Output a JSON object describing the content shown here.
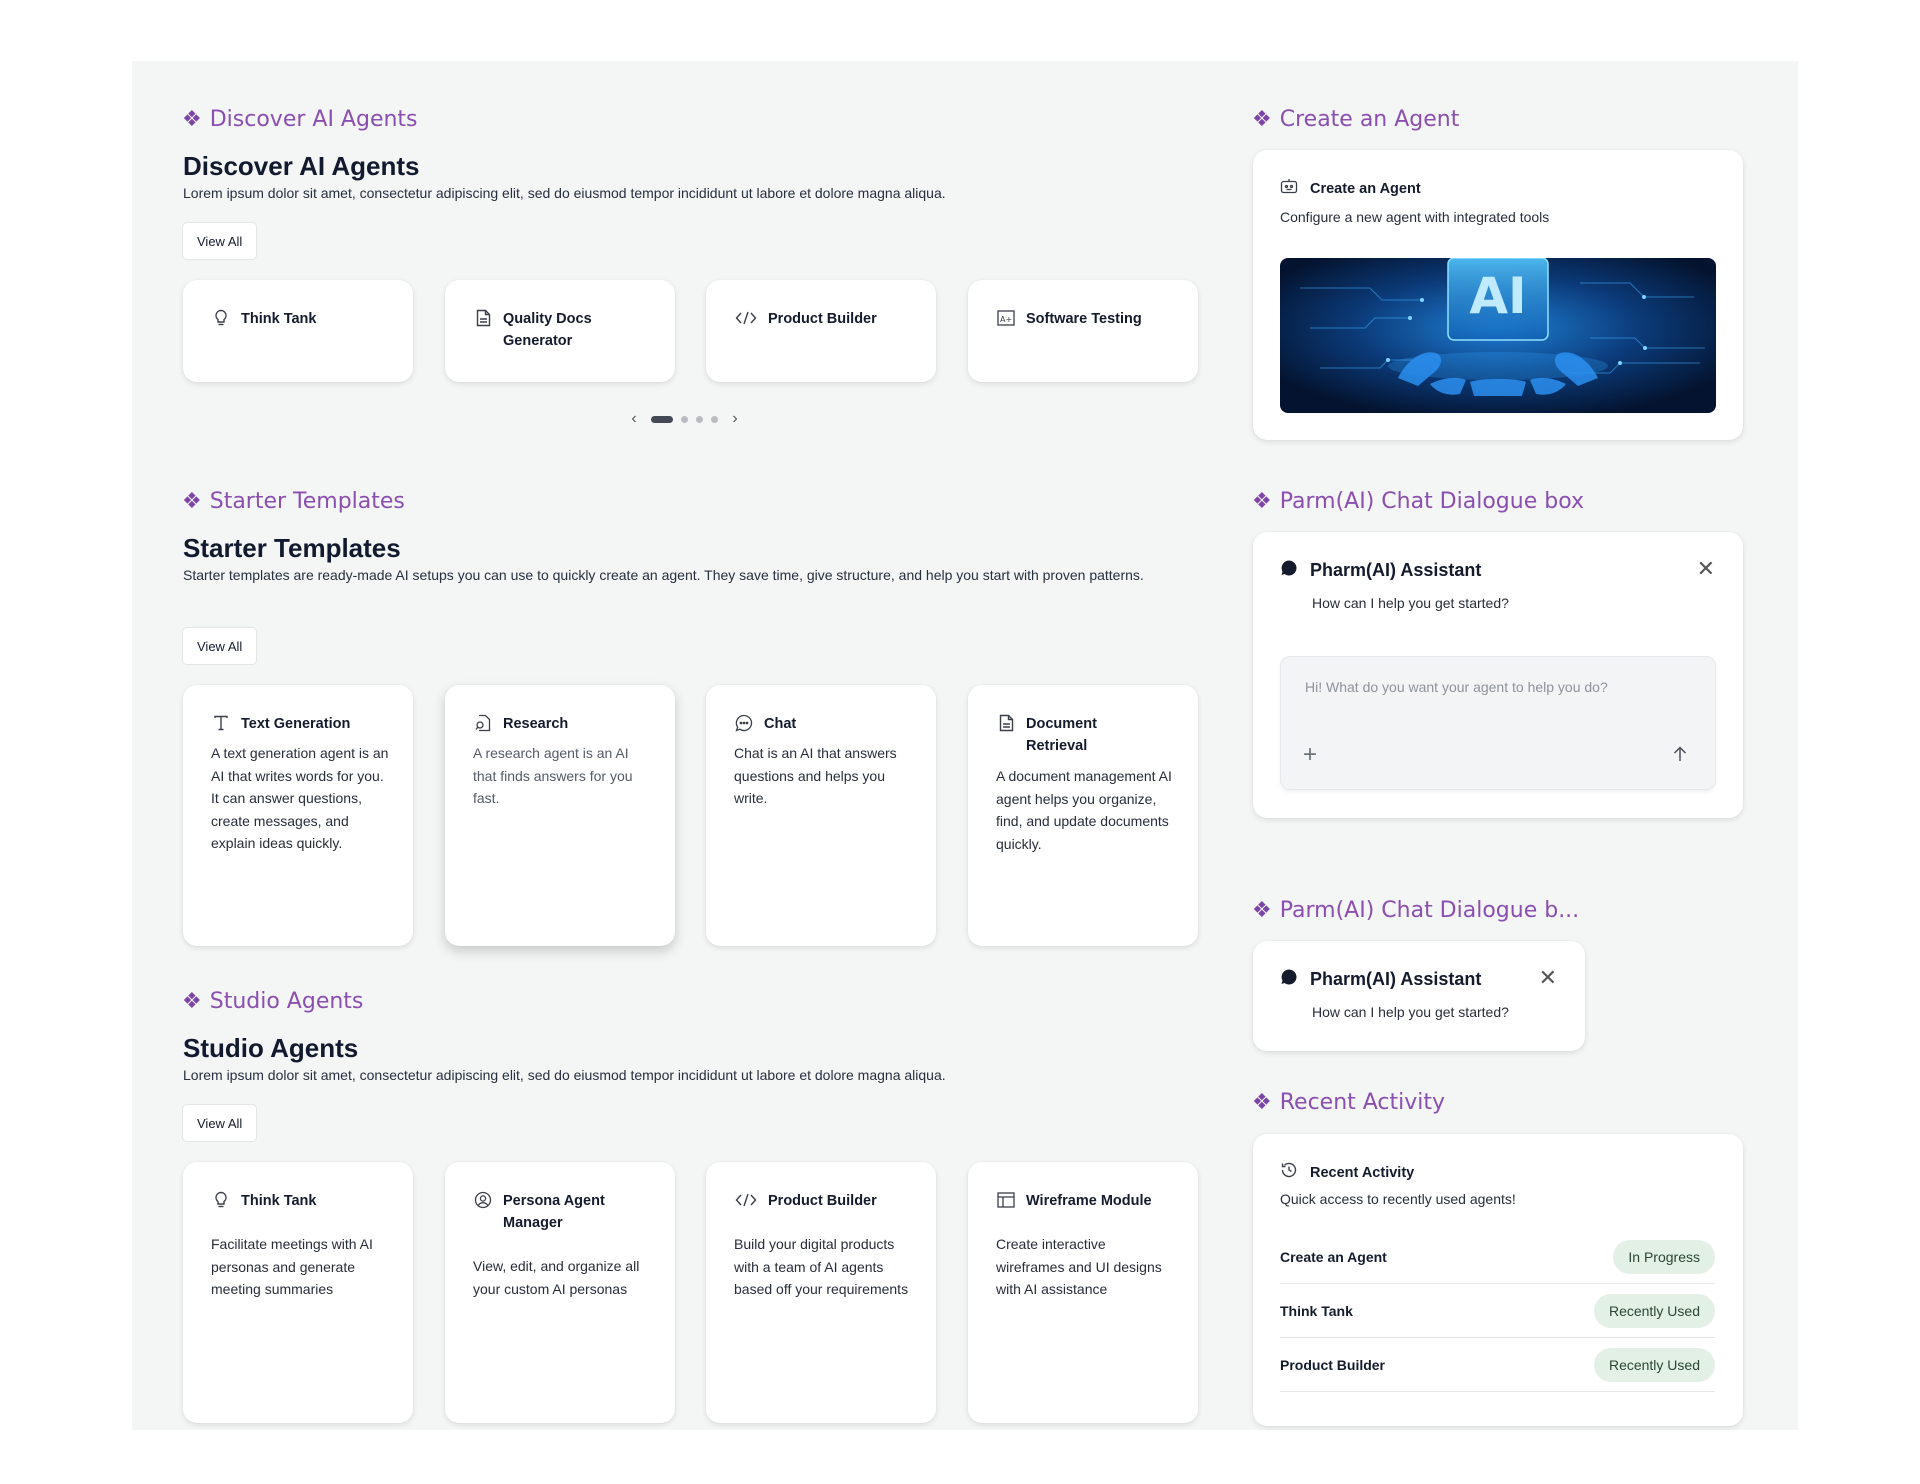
{
  "discover": {
    "label": "Discover AI Agents",
    "title": "Discover AI Agents",
    "desc": "Lorem ipsum dolor sit amet, consectetur adipiscing elit, sed do eiusmod tempor incididunt ut labore et dolore magna aliqua.",
    "view_all": "View All",
    "cards": [
      {
        "title": "Think Tank",
        "icon": "lightbulb-icon"
      },
      {
        "title": "Quality Docs Generator",
        "icon": "document-icon"
      },
      {
        "title": "Product Builder",
        "icon": "code-icon"
      },
      {
        "title": "Software Testing",
        "icon": "grade-icon"
      }
    ],
    "carousel": {
      "pages": 4,
      "active": 1
    }
  },
  "starter": {
    "label": "Starter Templates",
    "title": "Starter Templates",
    "desc": "Starter templates are ready-made AI setups you can use to quickly create an agent. They save time, give structure, and help you start with proven patterns.",
    "view_all": "View All",
    "cards": [
      {
        "title": "Text Generation",
        "icon": "text-icon",
        "body": "A text generation agent is an AI that writes words for you. It can answer questions, create messages, and explain ideas quickly."
      },
      {
        "title": "Research",
        "icon": "research-icon",
        "body": "A research agent is an AI that finds answers for you fast."
      },
      {
        "title": "Chat",
        "icon": "chat-icon",
        "body": "Chat is an AI that answers questions and helps you write."
      },
      {
        "title": "Document Retrieval",
        "icon": "document-icon",
        "body": "A document management AI agent helps you organize, find, and update documents quickly."
      }
    ]
  },
  "studio": {
    "label": "Studio Agents",
    "title": "Studio Agents",
    "desc": "Lorem ipsum dolor sit amet, consectetur adipiscing elit, sed do eiusmod tempor incididunt ut labore et dolore magna aliqua.",
    "view_all": "View All",
    "cards": [
      {
        "title": "Think Tank",
        "icon": "lightbulb-icon",
        "body": "Facilitate meetings with AI personas and generate meeting summaries"
      },
      {
        "title": "Persona Agent Manager",
        "icon": "user-circle-icon",
        "body": "View, edit, and organize all your custom AI personas"
      },
      {
        "title": "Product Builder",
        "icon": "code-icon",
        "body": "Build your digital products with a team of AI agents based off your requirements"
      },
      {
        "title": "Wireframe Module",
        "icon": "layout-icon",
        "body": "Create interactive wireframes and UI designs with AI assistance"
      }
    ]
  },
  "create": {
    "label": "Create an Agent",
    "card_title": "Create an Agent",
    "card_sub": "Configure a new agent with integrated tools",
    "hero_text": "AI"
  },
  "chat_full": {
    "label": "Parm(AI) Chat Dialogue box",
    "title": "Pharm(AI) Assistant",
    "sub": "How can I help you get started?",
    "placeholder": "Hi! What do you want your agent to help you do?"
  },
  "chat_compact": {
    "label": "Parm(AI) Chat Dialogue b...",
    "title": "Pharm(AI) Assistant",
    "sub": "How can I help you get started?"
  },
  "recent": {
    "label": "Recent Activity",
    "title": "Recent Activity",
    "sub": "Quick access to recently used agents!",
    "rows": [
      {
        "name": "Create an Agent",
        "status": "In Progress"
      },
      {
        "name": "Think Tank",
        "status": "Recently Used"
      },
      {
        "name": "Product Builder",
        "status": "Recently Used"
      }
    ]
  },
  "colors": {
    "accent": "#8a4fb0",
    "badge_bg": "#e3f0e6",
    "canvas_bg": "#f4f5f5"
  }
}
